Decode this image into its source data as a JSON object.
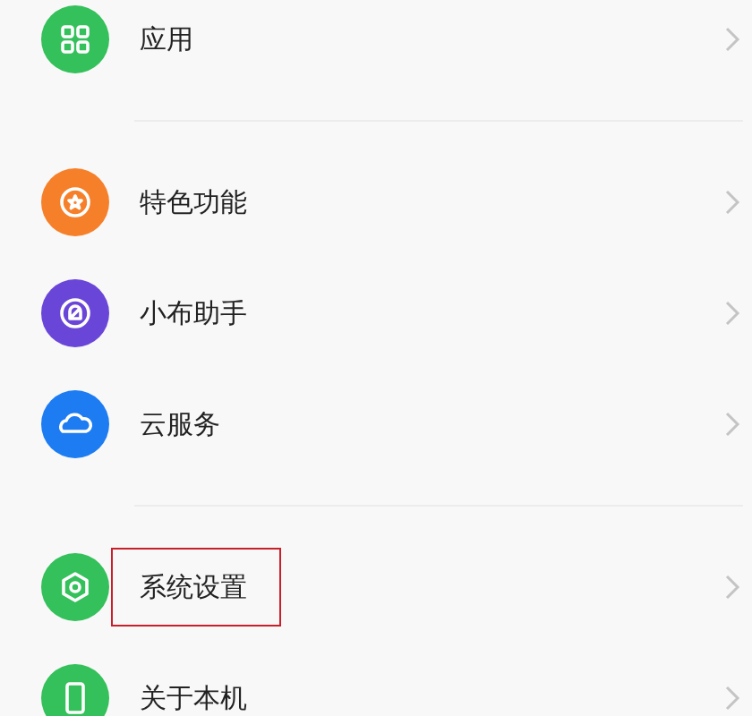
{
  "groups": [
    {
      "items": [
        {
          "label": "应用",
          "kind": "apps",
          "color": "#34c05a",
          "highlighted": false
        }
      ]
    },
    {
      "items": [
        {
          "label": "特色功能",
          "kind": "star",
          "color": "#f6802a",
          "highlighted": false
        },
        {
          "label": "小布助手",
          "kind": "assistant",
          "color": "#6a46d8",
          "highlighted": false
        },
        {
          "label": "云服务",
          "kind": "cloud",
          "color": "#1d7cf2",
          "highlighted": false
        }
      ]
    },
    {
      "items": [
        {
          "label": "系统设置",
          "kind": "settings",
          "color": "#34c05a",
          "highlighted": true
        },
        {
          "label": "关于本机",
          "kind": "phone",
          "color": "#34c05a",
          "highlighted": false
        }
      ]
    }
  ]
}
